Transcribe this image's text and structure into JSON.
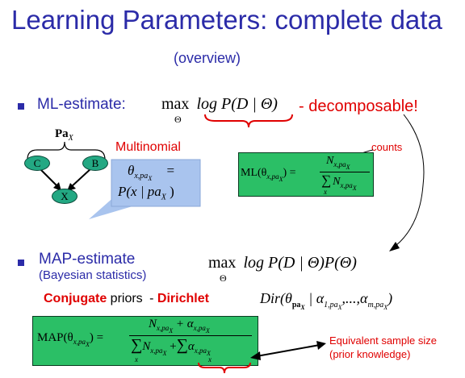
{
  "title": "Learning Parameters: complete data",
  "subtitle": "(overview)",
  "ml": {
    "label": "ML-estimate:",
    "formula_max": "max",
    "formula_sub": "Θ",
    "formula_body": "log P(D | Θ)",
    "decomposable": "- decomposable!"
  },
  "network": {
    "pa_label": "Pa",
    "pa_sub": "X",
    "nodes": [
      "C",
      "B",
      "X"
    ]
  },
  "multinomial": {
    "label": "Multinomial",
    "theta": "θ",
    "theta_sub": "x,pa",
    "theta_subsub": "X",
    "eq": "=",
    "rhs": "P(x | pa",
    "rhs_sub": "X",
    "rhs_close": ")"
  },
  "counts_label": "counts",
  "ml_formula": {
    "lhs": "ML(θ",
    "lhs_sub": "x,pa",
    "lhs_subsub": "X",
    "lhs_close": ") =",
    "num": "N",
    "num_sub": "x,pa",
    "num_subsub": "X",
    "den_sum": "∑",
    "den_sum_sub": "x",
    "den": "N",
    "den_sub": "x,pa",
    "den_subsub": "X"
  },
  "map": {
    "label": "MAP-estimate",
    "sublabel": "(Bayesian statistics)",
    "formula_max": "max",
    "formula_sub": "Θ",
    "formula_body": "log P(D | Θ)P(Θ)"
  },
  "priors": {
    "conjugate": "Conjugate",
    "priors_word": "priors",
    "dash": "-",
    "dirichlet": "Dirichlet",
    "dir_formula": "Dir(θ",
    "dir_sub1": "pa",
    "dir_sub1b": "X",
    "dir_mid": "| α",
    "dir_sub2": "1,pa",
    "dir_sub2b": "X",
    "dir_dots": ",...,α",
    "dir_sub3": "m,pa",
    "dir_sub3b": "X",
    "dir_close": ")"
  },
  "map_formula": {
    "lhs": "MAP(θ",
    "lhs_sub": "x,pa",
    "lhs_subsub": "X",
    "lhs_close": ") =",
    "num": "N",
    "num_sub": "x,pa",
    "num_subsub": "X",
    "num_plus": "+ α",
    "num_alpha_sub": "x,pa",
    "num_alpha_subsub": "X",
    "den_sum": "∑",
    "den_sum_sub": "x",
    "den_n": "N",
    "den_n_sub": "x,pa",
    "den_n_subsub": "X",
    "den_plus": "+",
    "den_sum2": "∑",
    "den_sum2_sub": "x",
    "den_alpha": "α",
    "den_alpha_sub": "x,pa",
    "den_alpha_subsub": "X"
  },
  "equiv": {
    "line1": "Equivalent sample size",
    "line2": "(prior knowledge)"
  },
  "colors": {
    "title_blue": "#2b2ba8",
    "red": "#e00000",
    "green_box": "#2bbf66",
    "node_green": "#23a883",
    "callout_blue": "#a9c4ee"
  }
}
